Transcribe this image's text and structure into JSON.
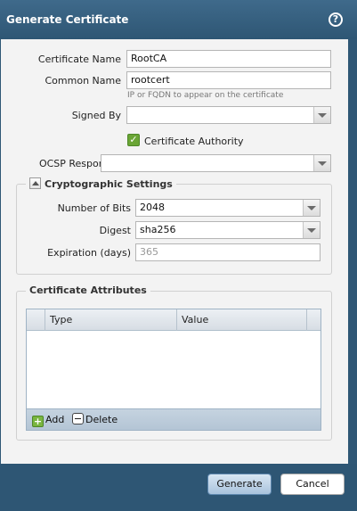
{
  "dialog": {
    "title": "Generate Certificate",
    "help_symbol": "?"
  },
  "form": {
    "certificate_name": {
      "label": "Certificate Name",
      "value": "RootCA"
    },
    "common_name": {
      "label": "Common Name",
      "value": "rootcert",
      "hint": "IP or FQDN to appear on the certificate"
    },
    "signed_by": {
      "label": "Signed By",
      "value": ""
    },
    "certificate_authority": {
      "label": "Certificate Authority",
      "checked": true,
      "check_mark": "✓"
    },
    "ocsp_responder": {
      "label": "OCSP Responder",
      "value": ""
    }
  },
  "crypto": {
    "legend": "Cryptographic Settings",
    "number_of_bits": {
      "label": "Number of Bits",
      "value": "2048"
    },
    "digest": {
      "label": "Digest",
      "value": "sha256"
    },
    "expiration": {
      "label": "Expiration (days)",
      "placeholder": "365"
    }
  },
  "attributes": {
    "legend": "Certificate Attributes",
    "columns": [
      "Type",
      "Value"
    ],
    "rows": [],
    "add_label": "Add",
    "delete_label": "Delete",
    "add_symbol": "+"
  },
  "buttons": {
    "generate": "Generate",
    "cancel": "Cancel"
  },
  "colors": {
    "titlebar": "#2e5674",
    "accent_green": "#6aa535",
    "panel": "#f3f3f3"
  }
}
